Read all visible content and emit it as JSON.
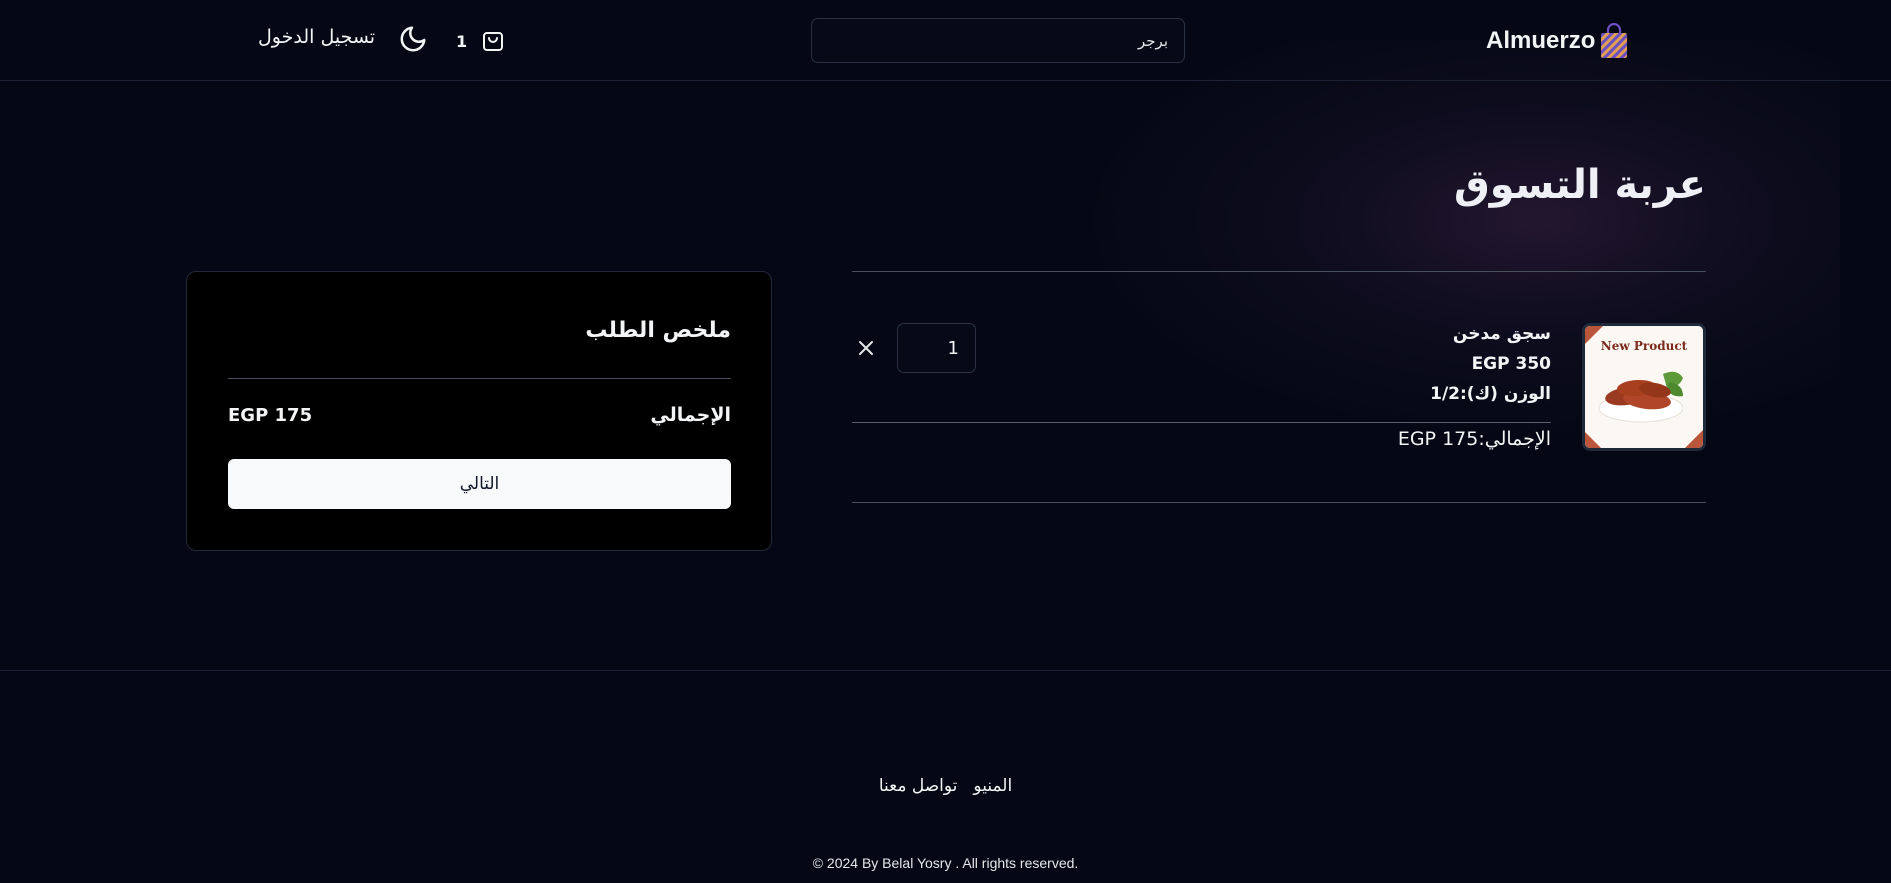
{
  "header": {
    "brand": "Almuerzo",
    "search_value": "برجر",
    "cart_count": "1",
    "login_label": "تسجيل الدخول"
  },
  "page": {
    "title": "عربة التسوق"
  },
  "cart": {
    "items": [
      {
        "name": "سجق مدخن",
        "price": "EGP 350",
        "weight": "الوزن (ك):1/2",
        "total": "الإجمالي:175 EGP",
        "quantity": "1",
        "image_text": "New Product"
      }
    ]
  },
  "summary": {
    "title": "ملخص الطلب",
    "total_label": "الإجمالي",
    "total_value": "EGP 175",
    "next_label": "التالي"
  },
  "footer": {
    "links": [
      "المنيو",
      "تواصل معنا"
    ],
    "copyright": "© 2024 By Belal Yosry . All rights reserved."
  },
  "colors": {
    "background": "#050814",
    "summary_bg": "#000000",
    "button_bg": "#f8f9fb"
  }
}
